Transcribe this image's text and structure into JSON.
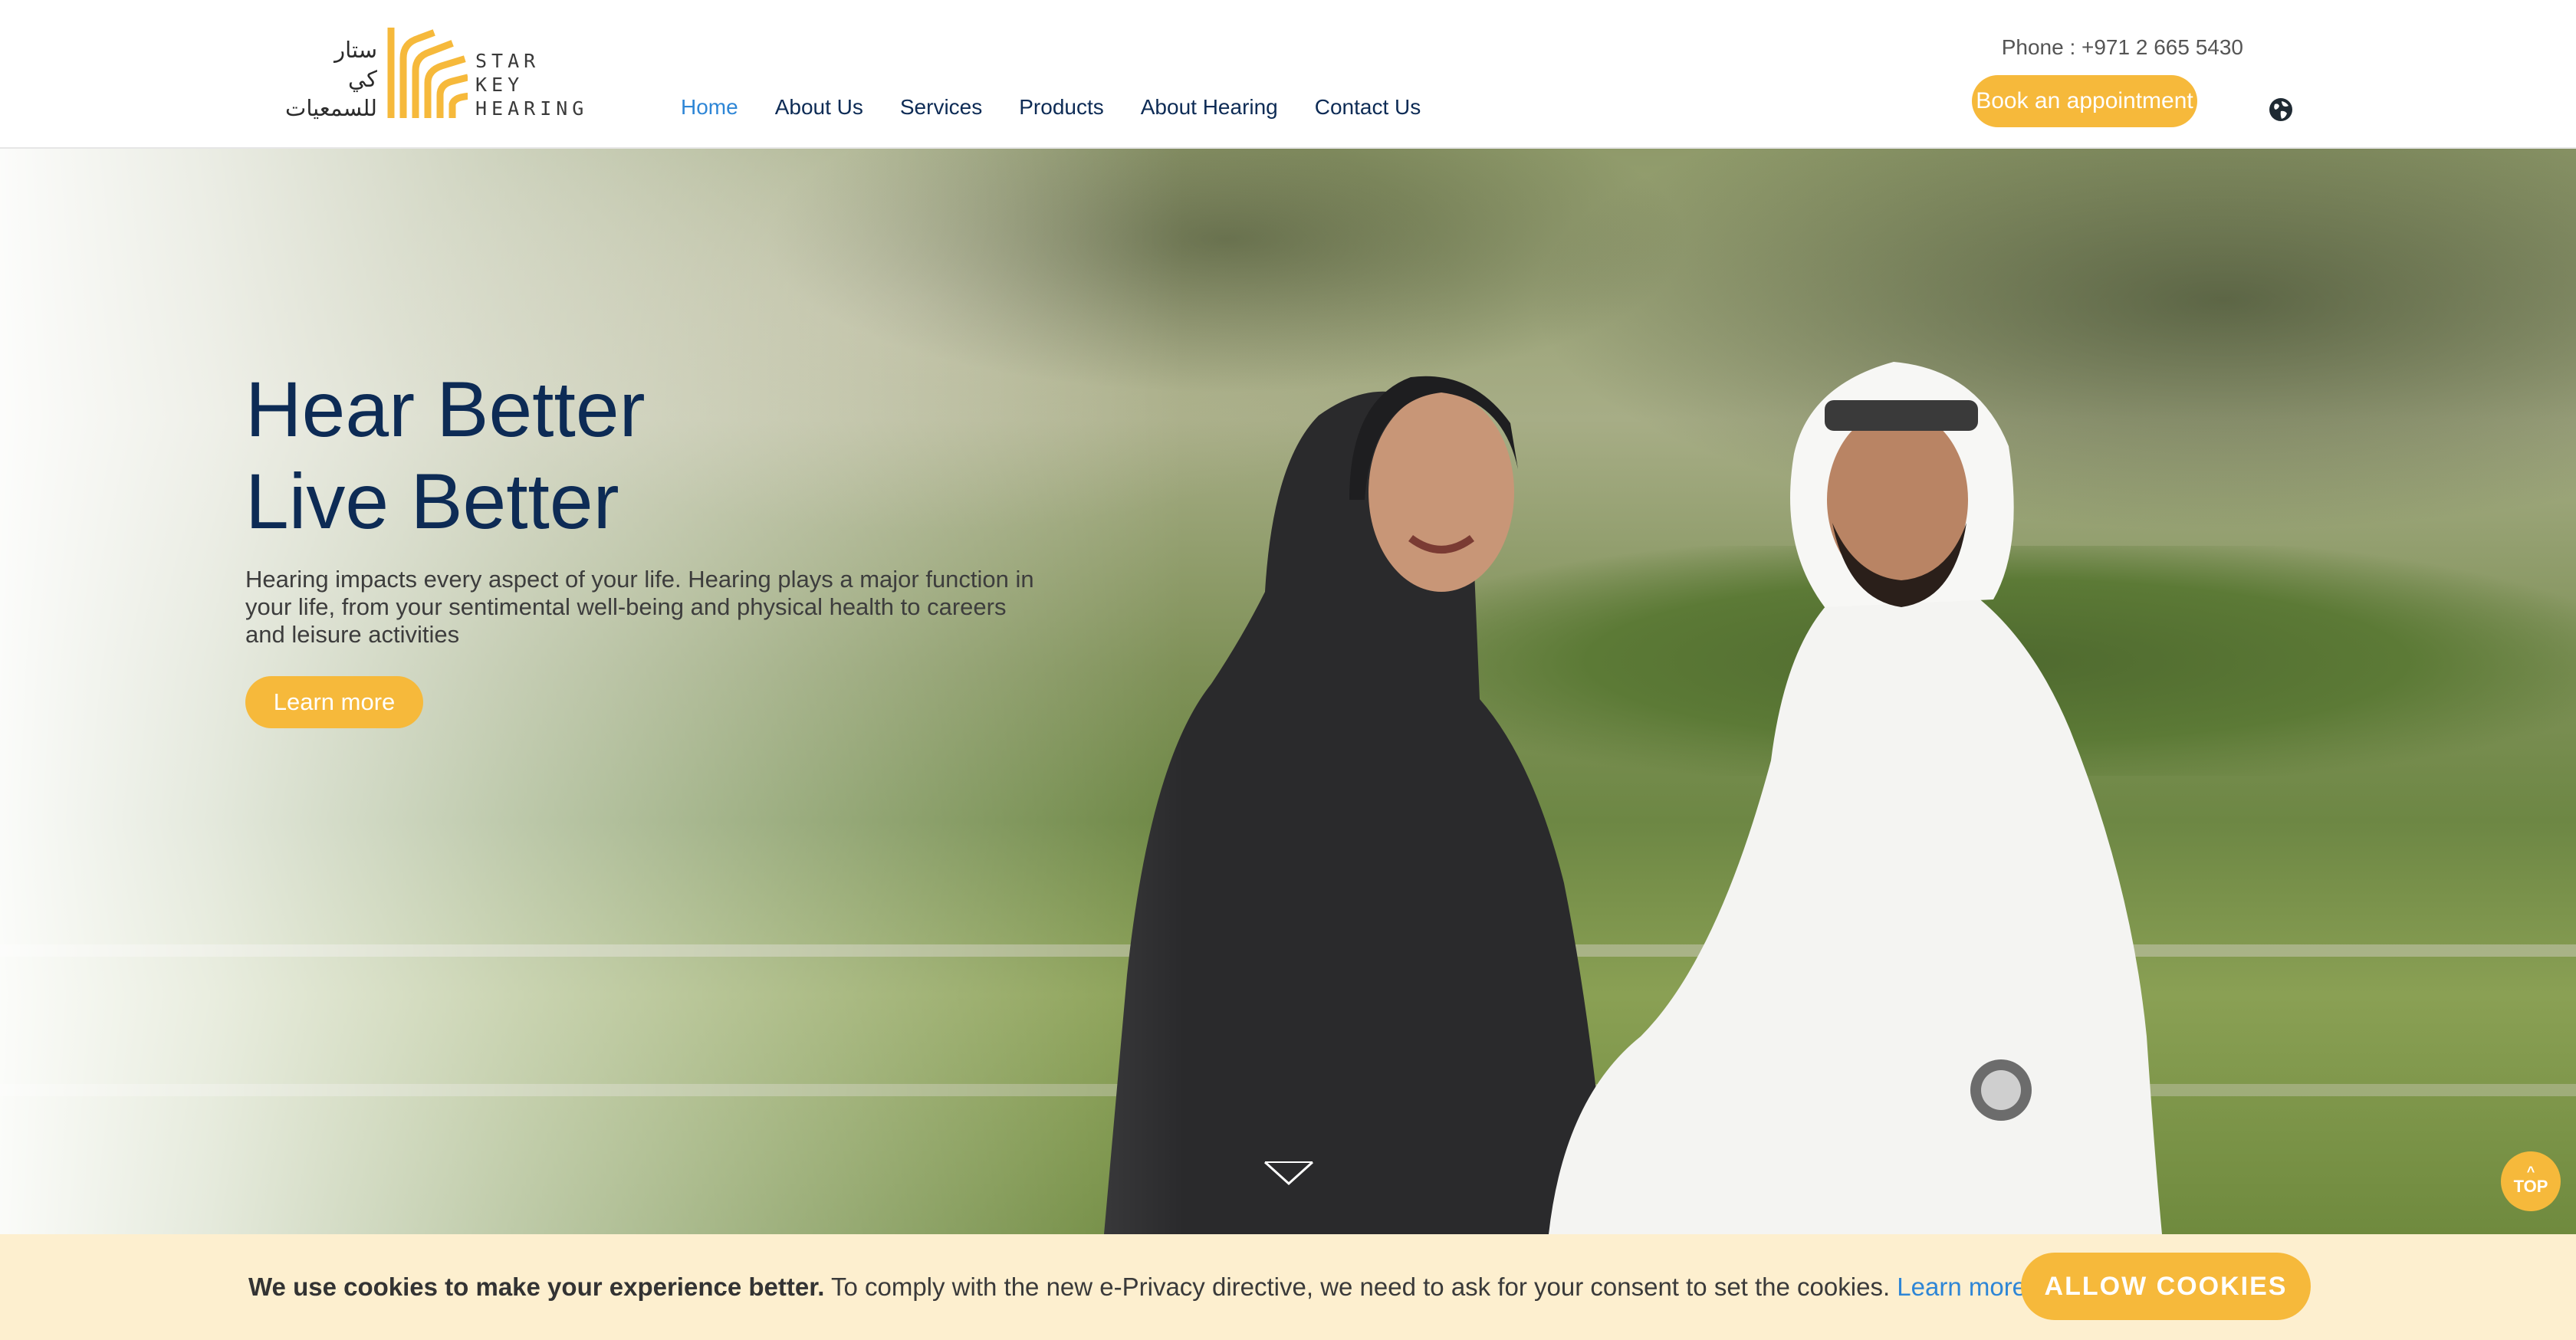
{
  "brand": {
    "arabic_name": [
      "ستار",
      "كي",
      "للسمعيات"
    ],
    "logo_words": [
      "STAR",
      "KEY",
      "HEARING"
    ],
    "accent": "#f6b93b",
    "navy": "#0d2b55",
    "link_blue": "#2e86d6"
  },
  "nav": {
    "items": [
      {
        "label": "Home",
        "active": true
      },
      {
        "label": "About Us"
      },
      {
        "label": "Services"
      },
      {
        "label": "Products"
      },
      {
        "label": "About Hearing"
      },
      {
        "label": "Contact Us"
      }
    ]
  },
  "header": {
    "phone": "Phone : +971 2 665 5430",
    "book_label": "Book an appointment",
    "language_icon": "globe-icon"
  },
  "hero": {
    "title_line1": "Hear Better",
    "title_line2": "Live Better",
    "description": "Hearing impacts every aspect of your life. Hearing plays a major function in your life, from your sentimental well-being and physical health to careers and leisure activities",
    "cta_label": "Learn more",
    "scroll_icon": "chevron-down-icon"
  },
  "top_button": {
    "label": "TOP"
  },
  "cookie": {
    "bold": "We use cookies to make your experience better.",
    "text": " To comply with the new e-Privacy directive, we need to ask for your consent to set the cookies. ",
    "link": "Learn more",
    "after_link": ".",
    "button": "ALLOW COOKIES"
  }
}
